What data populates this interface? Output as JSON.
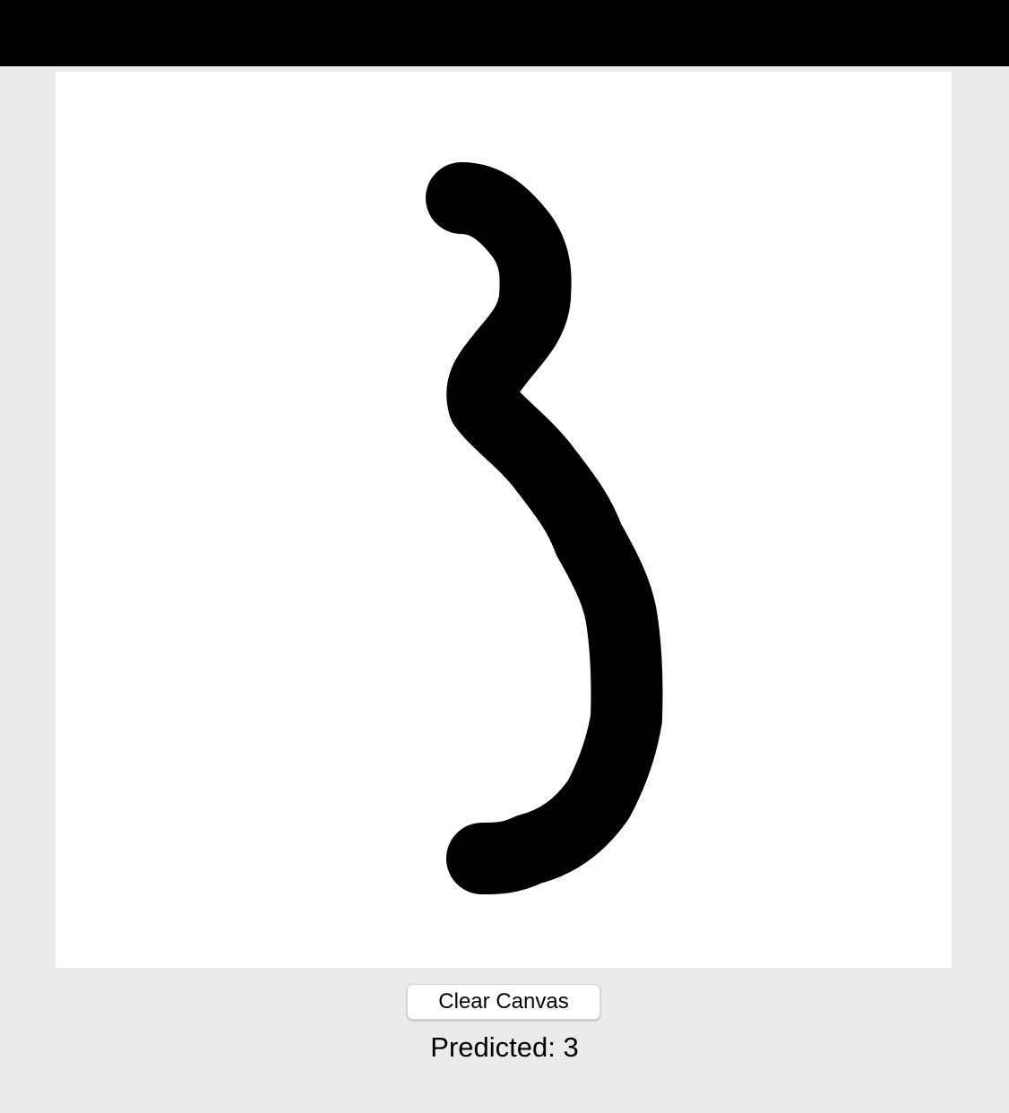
{
  "toolbar": {
    "clear_label": "Clear Canvas"
  },
  "prediction": {
    "prefix": "Predicted:",
    "value": "3"
  },
  "colors": {
    "top_bar": "#000000",
    "page_background": "#ebebeb",
    "canvas_background": "#ffffff",
    "stroke": "#000000"
  }
}
